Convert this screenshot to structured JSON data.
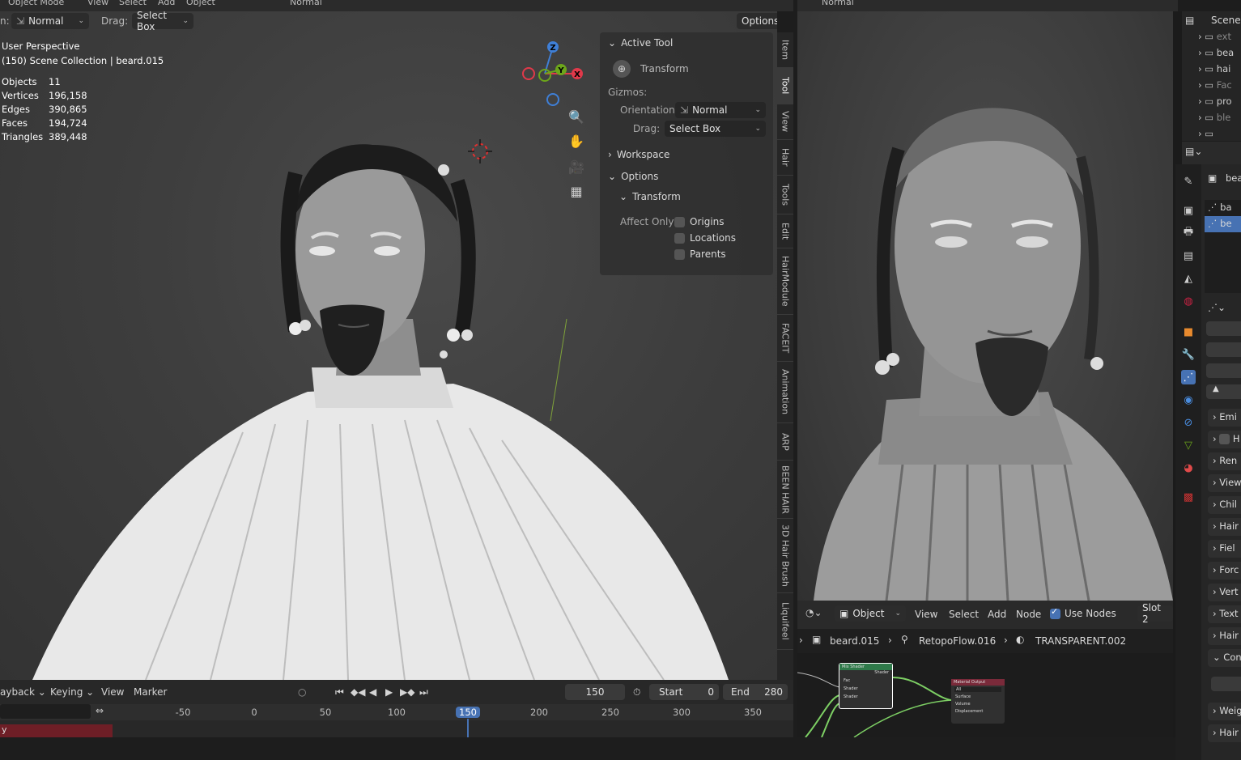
{
  "top_header": {
    "mode": "Object Mode",
    "menus": [
      "View",
      "Select",
      "Add",
      "Object"
    ],
    "orientation": "Normal",
    "right_orientation": "Normal"
  },
  "tool_header": {
    "orientation_label": "n:",
    "orientation_value": "Normal",
    "drag_label": "Drag:",
    "drag_value": "Select Box",
    "options_label": "Options"
  },
  "viewport_overlay": {
    "perspective": "User Perspective",
    "collection": "(150) Scene Collection | beard.015",
    "stats": [
      {
        "label": "Objects",
        "value": "11"
      },
      {
        "label": "Vertices",
        "value": "196,158"
      },
      {
        "label": "Edges",
        "value": "390,865"
      },
      {
        "label": "Faces",
        "value": "194,724"
      },
      {
        "label": "Triangles",
        "value": "389,448"
      }
    ]
  },
  "gizmo": {
    "z": "Z",
    "y": "Y",
    "x": "X"
  },
  "n_panel": {
    "active_tool_header": "Active Tool",
    "transform_tool": "Transform",
    "gizmos_label": "Gizmos:",
    "orientation_label": "Orientation",
    "orientation_value": "Normal",
    "drag_label": "Drag:",
    "drag_value": "Select Box",
    "workspace_header": "Workspace",
    "options_header": "Options",
    "transform_header": "Transform",
    "affect_only_label": "Affect Only",
    "affect_items": [
      "Origins",
      "Locations",
      "Parents"
    ]
  },
  "sidebar_tabs": [
    "Item",
    "Tool",
    "View",
    "Hair",
    "Tools",
    "Edit",
    "HairModule",
    "FACEIT",
    "Animation",
    "ARP",
    "BEEN HAIR",
    "3D Hair Brush",
    "Liquifeel"
  ],
  "timeline": {
    "playback": "ayback",
    "keying": "Keying",
    "view": "View",
    "marker": "Marker",
    "current_frame": "150",
    "start_label": "Start",
    "start_value": "0",
    "end_label": "End",
    "end_value": "280",
    "ticks": [
      "-50",
      "0",
      "50",
      "100",
      "150",
      "200",
      "250",
      "300",
      "350"
    ],
    "playhead": "150",
    "track_label": "y"
  },
  "node_editor": {
    "object_type": "Object",
    "menus": [
      "View",
      "Select",
      "Add",
      "Node"
    ],
    "use_nodes": "Use Nodes",
    "slot": "Slot 2",
    "breadcrumb": [
      "beard.015",
      "RetopoFlow.016",
      "TRANSPARENT.002"
    ],
    "node_mix": "Mix Shader",
    "node_mix_sockets": [
      "Fac",
      "Shader",
      "Shader"
    ],
    "node_mix_out": "Shader",
    "node_output": "Material Output",
    "node_output_target": "All",
    "node_output_sockets": [
      "Surface",
      "Volume",
      "Displacement"
    ]
  },
  "outliner": {
    "scene": "Scene",
    "items": [
      "ext",
      "bea",
      "hai",
      "Fac",
      "pro",
      "ble",
      ""
    ]
  },
  "properties": {
    "object_name": "bea",
    "list_items": [
      "ba",
      "be"
    ],
    "panels": [
      "Emi",
      "H",
      "Ren",
      "View",
      "Chil",
      "Hair",
      "Fiel",
      "Forc",
      "Vert",
      "Text",
      "Hair",
      "Con",
      "Weig",
      "Hair"
    ]
  },
  "colors": {
    "axis_x": "#e0394a",
    "axis_y": "#6ca51b",
    "axis_z": "#3f7fd6",
    "accent": "#4772b3",
    "playhead": "#4772b3"
  }
}
